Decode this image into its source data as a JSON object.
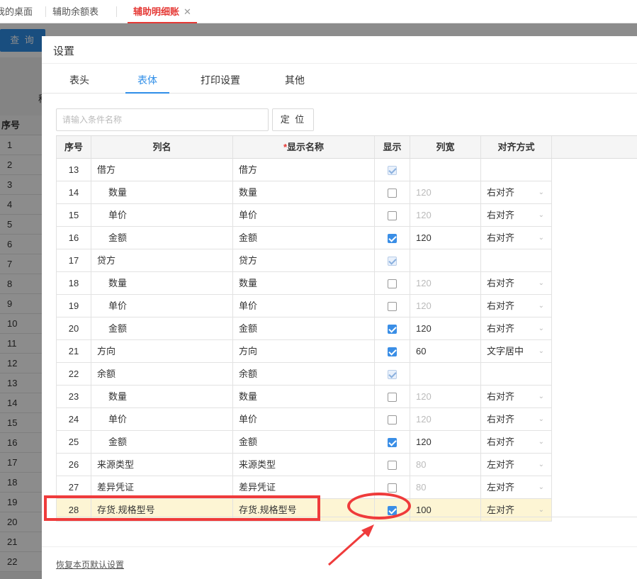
{
  "tabs": [
    {
      "label": "我的桌面"
    },
    {
      "label": "辅助余额表"
    },
    {
      "label": "辅助明细账",
      "close": "✕"
    }
  ],
  "background": {
    "query_button": "查 询",
    "partial_label": "稿",
    "grid_header": "序号",
    "row_numbers": [
      "1",
      "2",
      "3",
      "4",
      "5",
      "6",
      "7",
      "8",
      "9",
      "10",
      "11",
      "12",
      "13",
      "14",
      "15",
      "16",
      "17",
      "18",
      "19",
      "20",
      "21",
      "22"
    ]
  },
  "dialog": {
    "title": "设置",
    "tabs": [
      "表头",
      "表体",
      "打印设置",
      "其他"
    ],
    "active_tab": "表体",
    "search_placeholder": "请输入条件名称",
    "locate_button": "定 位",
    "columns": {
      "seq": "序号",
      "name": "列名",
      "display_name_required": "*",
      "display_name": "显示名称",
      "show": "显示",
      "width": "列宽",
      "align": "对齐方式"
    },
    "rows": [
      {
        "seq": "13",
        "name": "借方",
        "display": "借方",
        "indent": false,
        "show": "disabled",
        "width": "",
        "align": ""
      },
      {
        "seq": "14",
        "name": "数量",
        "display": "数量",
        "indent": true,
        "show": "off",
        "width": "120",
        "align": "右对齐"
      },
      {
        "seq": "15",
        "name": "单价",
        "display": "单价",
        "indent": true,
        "show": "off",
        "width": "120",
        "align": "右对齐"
      },
      {
        "seq": "16",
        "name": "金额",
        "display": "金额",
        "indent": true,
        "show": "on",
        "width": "120",
        "align": "右对齐"
      },
      {
        "seq": "17",
        "name": "贷方",
        "display": "贷方",
        "indent": false,
        "show": "disabled",
        "width": "",
        "align": ""
      },
      {
        "seq": "18",
        "name": "数量",
        "display": "数量",
        "indent": true,
        "show": "off",
        "width": "120",
        "align": "右对齐"
      },
      {
        "seq": "19",
        "name": "单价",
        "display": "单价",
        "indent": true,
        "show": "off",
        "width": "120",
        "align": "右对齐"
      },
      {
        "seq": "20",
        "name": "金额",
        "display": "金额",
        "indent": true,
        "show": "on",
        "width": "120",
        "align": "右对齐"
      },
      {
        "seq": "21",
        "name": "方向",
        "display": "方向",
        "indent": false,
        "show": "on",
        "width": "60",
        "align": "文字居中"
      },
      {
        "seq": "22",
        "name": "余额",
        "display": "余额",
        "indent": false,
        "show": "disabled",
        "width": "",
        "align": ""
      },
      {
        "seq": "23",
        "name": "数量",
        "display": "数量",
        "indent": true,
        "show": "off",
        "width": "120",
        "align": "右对齐"
      },
      {
        "seq": "24",
        "name": "单价",
        "display": "单价",
        "indent": true,
        "show": "off",
        "width": "120",
        "align": "右对齐"
      },
      {
        "seq": "25",
        "name": "金额",
        "display": "金额",
        "indent": true,
        "show": "on",
        "width": "120",
        "align": "右对齐"
      },
      {
        "seq": "26",
        "name": "来源类型",
        "display": "来源类型",
        "indent": false,
        "show": "off",
        "width": "80",
        "align": "左对齐"
      },
      {
        "seq": "27",
        "name": "差异凭证",
        "display": "差异凭证",
        "indent": false,
        "show": "off",
        "width": "80",
        "align": "左对齐"
      },
      {
        "seq": "28",
        "name": "存货.规格型号",
        "display": "存货.规格型号",
        "indent": false,
        "show": "on",
        "width": "100",
        "align": "左对齐",
        "highlighted": true
      }
    ],
    "restore_link": "恢复本页默认设置"
  },
  "colors": {
    "accent": "#2f8ee8",
    "active_tab_red": "#e53935",
    "annotation_red": "#ef3b3b",
    "highlight_row": "#fdf5d4"
  },
  "icons": {
    "tab_close": "close-icon",
    "select_arrow": "chevron-down-icon",
    "checkbox": "checkbox-icon"
  }
}
